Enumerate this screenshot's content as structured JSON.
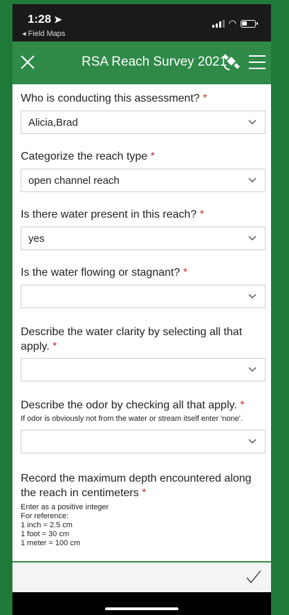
{
  "status_bar": {
    "time": "1:28",
    "back_app": "◂ Field Maps"
  },
  "header": {
    "title": "RSA Reach Survey 2021"
  },
  "form": {
    "questions": [
      {
        "label": "Who is conducting this assessment?",
        "required_marker": "*",
        "value": "Alicia,Brad"
      },
      {
        "label": "Categorize the reach type",
        "required_marker": "*",
        "value": "open channel reach"
      },
      {
        "label": "Is there water present in this reach?",
        "required_marker": "*",
        "value": "yes"
      },
      {
        "label": "Is the water flowing or stagnant?",
        "required_marker": "*",
        "value": ""
      },
      {
        "label": "Describe the water clarity by selecting all that apply.",
        "required_marker": "*",
        "value": ""
      },
      {
        "label": "Describe the odor by checking all that apply.",
        "required_marker": "*",
        "hint": "If odor is obviously not from the water or stream itself enter 'none'.",
        "value": ""
      },
      {
        "label": "Record the maximum depth encountered along the reach in centimeters",
        "required_marker": "*",
        "hint_lines": [
          "Enter as a positive integer",
          "For reference:",
          "1 inch = 2.5 cm",
          "1 foot = 30 cm",
          "1 meter = 100 cm"
        ]
      }
    ]
  },
  "colors": {
    "frame_green": "#1f7a3a",
    "header_green": "#2f8a48",
    "required_red": "#c9302c"
  }
}
